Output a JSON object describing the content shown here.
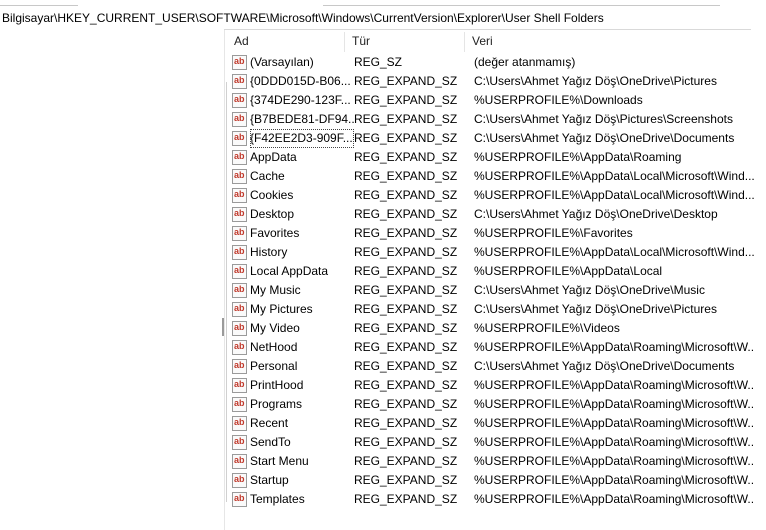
{
  "address": {
    "path": "Bilgisayar\\HKEY_CURRENT_USER\\SOFTWARE\\Microsoft\\Windows\\CurrentVersion\\Explorer\\User Shell Folders"
  },
  "columns": {
    "name": "Ad",
    "type": "Tür",
    "data": "Veri"
  },
  "icon": "registry-string-icon",
  "icon_text": "ab",
  "rows": [
    {
      "name": "(Varsayılan)",
      "type": "REG_SZ",
      "data": "(değer atanmamış)"
    },
    {
      "name": "{0DDD015D-B06...",
      "type": "REG_EXPAND_SZ",
      "data": "C:\\Users\\Ahmet Yağız Döş\\OneDrive\\Pictures"
    },
    {
      "name": "{374DE290-123F...",
      "type": "REG_EXPAND_SZ",
      "data": "%USERPROFILE%\\Downloads"
    },
    {
      "name": "{B7BEDE81-DF94...",
      "type": "REG_EXPAND_SZ",
      "data": "C:\\Users\\Ahmet Yağız Döş\\Pictures\\Screenshots"
    },
    {
      "name": "{F42EE2D3-909F...",
      "type": "REG_EXPAND_SZ",
      "data": "C:\\Users\\Ahmet Yağız Döş\\OneDrive\\Documents"
    },
    {
      "name": "AppData",
      "type": "REG_EXPAND_SZ",
      "data": "%USERPROFILE%\\AppData\\Roaming"
    },
    {
      "name": "Cache",
      "type": "REG_EXPAND_SZ",
      "data": "%USERPROFILE%\\AppData\\Local\\Microsoft\\Wind..."
    },
    {
      "name": "Cookies",
      "type": "REG_EXPAND_SZ",
      "data": "%USERPROFILE%\\AppData\\Local\\Microsoft\\Wind..."
    },
    {
      "name": "Desktop",
      "type": "REG_EXPAND_SZ",
      "data": "C:\\Users\\Ahmet Yağız Döş\\OneDrive\\Desktop"
    },
    {
      "name": "Favorites",
      "type": "REG_EXPAND_SZ",
      "data": "%USERPROFILE%\\Favorites"
    },
    {
      "name": "History",
      "type": "REG_EXPAND_SZ",
      "data": "%USERPROFILE%\\AppData\\Local\\Microsoft\\Wind..."
    },
    {
      "name": "Local AppData",
      "type": "REG_EXPAND_SZ",
      "data": "%USERPROFILE%\\AppData\\Local"
    },
    {
      "name": "My Music",
      "type": "REG_EXPAND_SZ",
      "data": "C:\\Users\\Ahmet Yağız Döş\\OneDrive\\Music"
    },
    {
      "name": "My Pictures",
      "type": "REG_EXPAND_SZ",
      "data": "C:\\Users\\Ahmet Yağız Döş\\OneDrive\\Pictures"
    },
    {
      "name": "My Video",
      "type": "REG_EXPAND_SZ",
      "data": "%USERPROFILE%\\Videos"
    },
    {
      "name": "NetHood",
      "type": "REG_EXPAND_SZ",
      "data": "%USERPROFILE%\\AppData\\Roaming\\Microsoft\\W..."
    },
    {
      "name": "Personal",
      "type": "REG_EXPAND_SZ",
      "data": "C:\\Users\\Ahmet Yağız Döş\\OneDrive\\Documents"
    },
    {
      "name": "PrintHood",
      "type": "REG_EXPAND_SZ",
      "data": "%USERPROFILE%\\AppData\\Roaming\\Microsoft\\W..."
    },
    {
      "name": "Programs",
      "type": "REG_EXPAND_SZ",
      "data": "%USERPROFILE%\\AppData\\Roaming\\Microsoft\\W..."
    },
    {
      "name": "Recent",
      "type": "REG_EXPAND_SZ",
      "data": "%USERPROFILE%\\AppData\\Roaming\\Microsoft\\W..."
    },
    {
      "name": "SendTo",
      "type": "REG_EXPAND_SZ",
      "data": "%USERPROFILE%\\AppData\\Roaming\\Microsoft\\W..."
    },
    {
      "name": "Start Menu",
      "type": "REG_EXPAND_SZ",
      "data": "%USERPROFILE%\\AppData\\Roaming\\Microsoft\\W..."
    },
    {
      "name": "Startup",
      "type": "REG_EXPAND_SZ",
      "data": "%USERPROFILE%\\AppData\\Roaming\\Microsoft\\W..."
    },
    {
      "name": "Templates",
      "type": "REG_EXPAND_SZ",
      "data": "%USERPROFILE%\\AppData\\Roaming\\Microsoft\\W..."
    }
  ]
}
